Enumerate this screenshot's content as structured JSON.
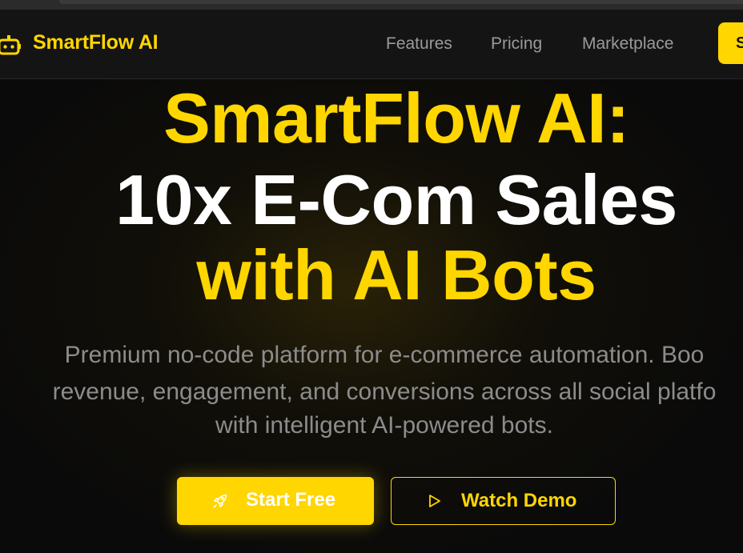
{
  "nav": {
    "brand": "SmartFlow AI",
    "links": [
      "Features",
      "Pricing",
      "Marketplace"
    ],
    "cta_label": "S"
  },
  "hero": {
    "line1": "SmartFlow AI:",
    "line2": "10x E-Com Sales",
    "line3": "with AI Bots",
    "subtitle_lines": [
      "Premium no-code platform for e-commerce automation. Boo",
      "revenue, engagement, and conversions across all social platfo",
      "with intelligent AI-powered bots."
    ]
  },
  "buttons": {
    "primary_label": "Start Free",
    "secondary_label": "Watch Demo"
  },
  "icons": {
    "logo": "robot-icon",
    "primary": "rocket-icon",
    "secondary": "play-icon"
  },
  "colors": {
    "accent": "#ffd600",
    "background": "#0a0a0a",
    "navbar": "#141414",
    "muted_text": "#8c8c8c",
    "nav_text": "#9a9a9a"
  }
}
